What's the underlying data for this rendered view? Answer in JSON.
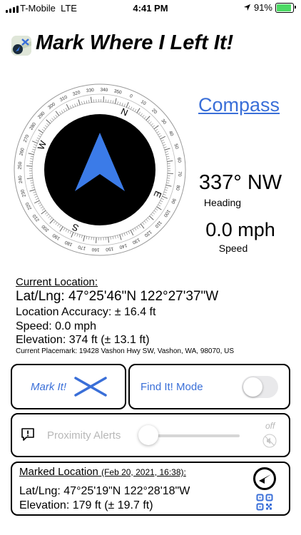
{
  "status_bar": {
    "carrier": "T-Mobile",
    "network": "LTE",
    "time": "4:41 PM",
    "battery": "91%",
    "battery_level": 0.91,
    "icons": [
      "signal-bars-icon",
      "location-arrow-icon",
      "battery-charging-icon"
    ]
  },
  "app": {
    "title": "Mark Where I Left It!",
    "icon": "app-logo-icon"
  },
  "compass": {
    "link_label": "Compass",
    "heading_value": "337° NW",
    "heading_label": "Heading",
    "speed_value": "0.0 mph",
    "speed_label": "Speed",
    "heading_degrees": 337,
    "cardinals": [
      "N",
      "E",
      "S",
      "W"
    ],
    "degree_labels": [
      "0",
      "10",
      "20",
      "30",
      "40",
      "50",
      "60",
      "70",
      "80",
      "90",
      "100",
      "110",
      "120",
      "130",
      "140",
      "150",
      "160",
      "170",
      "180",
      "190",
      "200",
      "210",
      "220",
      "230",
      "240",
      "250",
      "260",
      "270",
      "280",
      "290",
      "300",
      "310",
      "320",
      "330",
      "340",
      "350"
    ],
    "arrow_color": "#3b7be8",
    "dial_color": "#000000"
  },
  "current_location": {
    "title": "Current Location:",
    "latlng": "Lat/Lng: 47°25'46\"N  122°27'37\"W",
    "accuracy": "Location Accuracy: ± 16.4 ft",
    "speed": "Speed: 0.0 mph",
    "elevation": "Elevation: 374 ft (± 13.1 ft)",
    "placemark": "Current Placemark: 19428 Vashon Hwy SW, Vashon, WA, 98070, US"
  },
  "actions": {
    "mark_label": "Mark It!",
    "mark_icon": "x-cross-icon",
    "find_label": "Find It! Mode",
    "find_toggle_on": false
  },
  "proximity": {
    "label": "Proximity Alerts",
    "off_label": "off",
    "slider_value": 0,
    "icons": [
      "alert-bubble-icon",
      "mute-icon"
    ]
  },
  "marked_location": {
    "title": "Marked Location",
    "date": "(Feb 20, 2021, 16:38):",
    "latlng": "Lat/Lng: 47°25'19\"N  122°28'18\"W",
    "elevation": "Elevation: 179 ft (± 19.7 ft)",
    "icons": [
      "navigate-arrow-icon",
      "qr-code-icon"
    ]
  },
  "colors": {
    "accent": "#3a6fd8",
    "disabled": "#b8b8b8"
  }
}
